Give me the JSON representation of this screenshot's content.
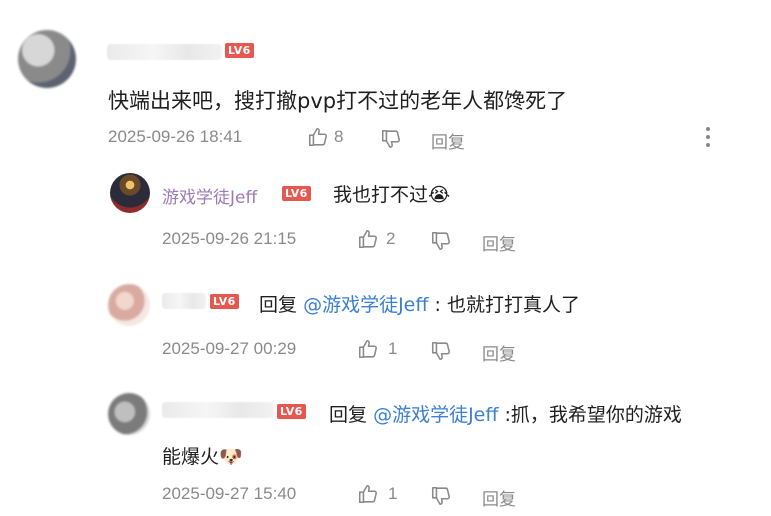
{
  "comments": [
    {
      "text": "快端出来吧，搜打撤pvp打不过的老年人都馋死了",
      "level": "LV6",
      "date": "2025-09-26 18:41",
      "likes": "8",
      "reply_label": "回复"
    }
  ],
  "replies": [
    {
      "username": "游戏学徒Jeff",
      "level": "LV6",
      "text": "我也打不过😭",
      "date": "2025-09-26 21:15",
      "likes": "2",
      "reply_label": "回复"
    },
    {
      "level": "LV6",
      "prefix": "回复",
      "mention": "@游戏学徒Jeff",
      "text": ": 也就打打真人了",
      "date": "2025-09-27 00:29",
      "likes": "1",
      "reply_label": "回复"
    },
    {
      "level": "LV6",
      "prefix": "回复",
      "mention": "@游戏学徒Jeff",
      "text_line1": ":抓，我希望你的游戏",
      "text_line2": "能爆火🐶",
      "date": "2025-09-27 15:40",
      "likes": "1",
      "reply_label": "回复"
    }
  ],
  "icons": [
    "thumb-up-icon",
    "thumb-down-icon",
    "more-options-icon"
  ],
  "colors": {
    "level_badge": "#e5574f",
    "mention": "#3b7fd0",
    "username": "#9c7ab5",
    "meta": "#8a8a8a"
  }
}
